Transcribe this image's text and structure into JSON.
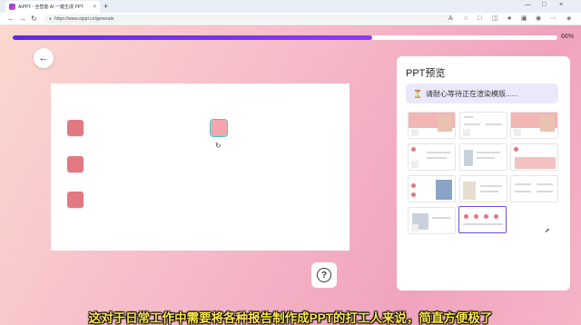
{
  "browser": {
    "tab_title": "AiPPT - 全智能 AI 一键生成 PPT",
    "tab_close": "×",
    "new_tab": "+",
    "url": "https://www.aippt.cn/generate",
    "window_controls": [
      "—",
      "□",
      "×"
    ],
    "nav_icons": [
      "back-arrow-icon",
      "forward-arrow-icon",
      "reload-icon"
    ]
  },
  "progress": {
    "percent": 66,
    "label": "66%",
    "bar_color": "#6a32e8"
  },
  "canvas": {
    "back_icon": "←",
    "rotate_icon": "↻",
    "help_icon": "?"
  },
  "preview_panel": {
    "title": "PPT预览",
    "status_icon": "⏳",
    "status_text": "请耐心等待正在渲染模版......",
    "thumbnail_count": 11,
    "active_thumbnail": 11
  },
  "caption": "这对于日常工作中需要将各种报告制作成PPT的打工人来说，简直方便极了",
  "colors": {
    "accent": "#6a4cd8",
    "shape": "#e27882",
    "caption": "#fce94a"
  }
}
